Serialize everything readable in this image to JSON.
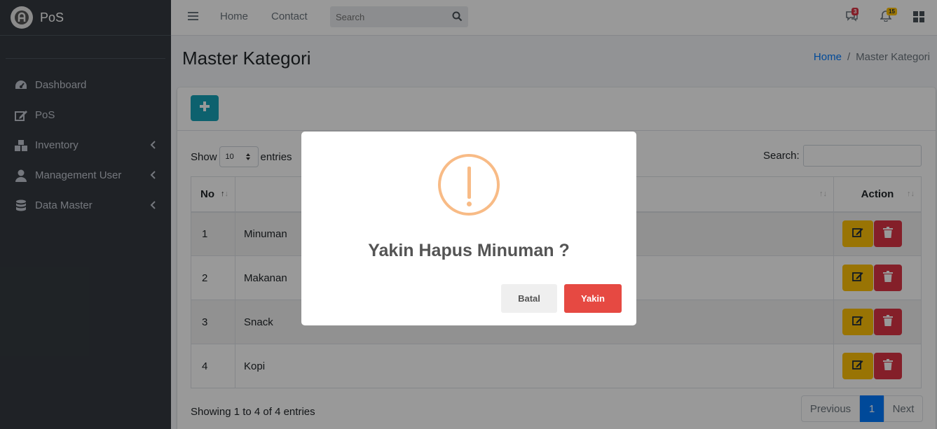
{
  "brand": {
    "name": "PoS",
    "logo_icon": "brand-logo-icon"
  },
  "sidebar": {
    "items": [
      {
        "label": "Dashboard",
        "icon": "tachometer-icon",
        "has_caret": false
      },
      {
        "label": "PoS",
        "icon": "edit-icon",
        "has_caret": false
      },
      {
        "label": "Inventory",
        "icon": "boxes-icon",
        "has_caret": true
      },
      {
        "label": "Management User",
        "icon": "user-icon",
        "has_caret": true
      },
      {
        "label": "Data Master",
        "icon": "database-icon",
        "has_caret": true
      }
    ]
  },
  "topbar": {
    "links": [
      "Home",
      "Contact"
    ],
    "search_placeholder": "Search",
    "messages_badge": "3",
    "notifications_badge": "15",
    "colors": {
      "messages_badge": "#dc3545",
      "notifications_badge": "#ffc107"
    }
  },
  "page": {
    "title": "Master Kategori",
    "breadcrumb": {
      "home": "Home",
      "separator": "/",
      "current": "Master Kategori"
    }
  },
  "table": {
    "show_label": "Show",
    "entries_label": "entries",
    "page_length": "10",
    "search_label": "Search:",
    "columns": [
      "No",
      "",
      "Action"
    ],
    "rows": [
      {
        "no": "1",
        "name": "Minuman"
      },
      {
        "no": "2",
        "name": "Makanan"
      },
      {
        "no": "3",
        "name": "Snack"
      },
      {
        "no": "4",
        "name": "Kopi"
      }
    ],
    "info": "Showing 1 to 4 of 4 entries",
    "pagination": {
      "previous": "Previous",
      "current": "1",
      "next": "Next"
    }
  },
  "modal": {
    "icon": "warning-icon",
    "title": "Yakin Hapus Minuman ?",
    "cancel_label": "Batal",
    "confirm_label": "Yakin",
    "colors": {
      "confirm": "#e64942",
      "warning": "#f8bb86"
    }
  }
}
